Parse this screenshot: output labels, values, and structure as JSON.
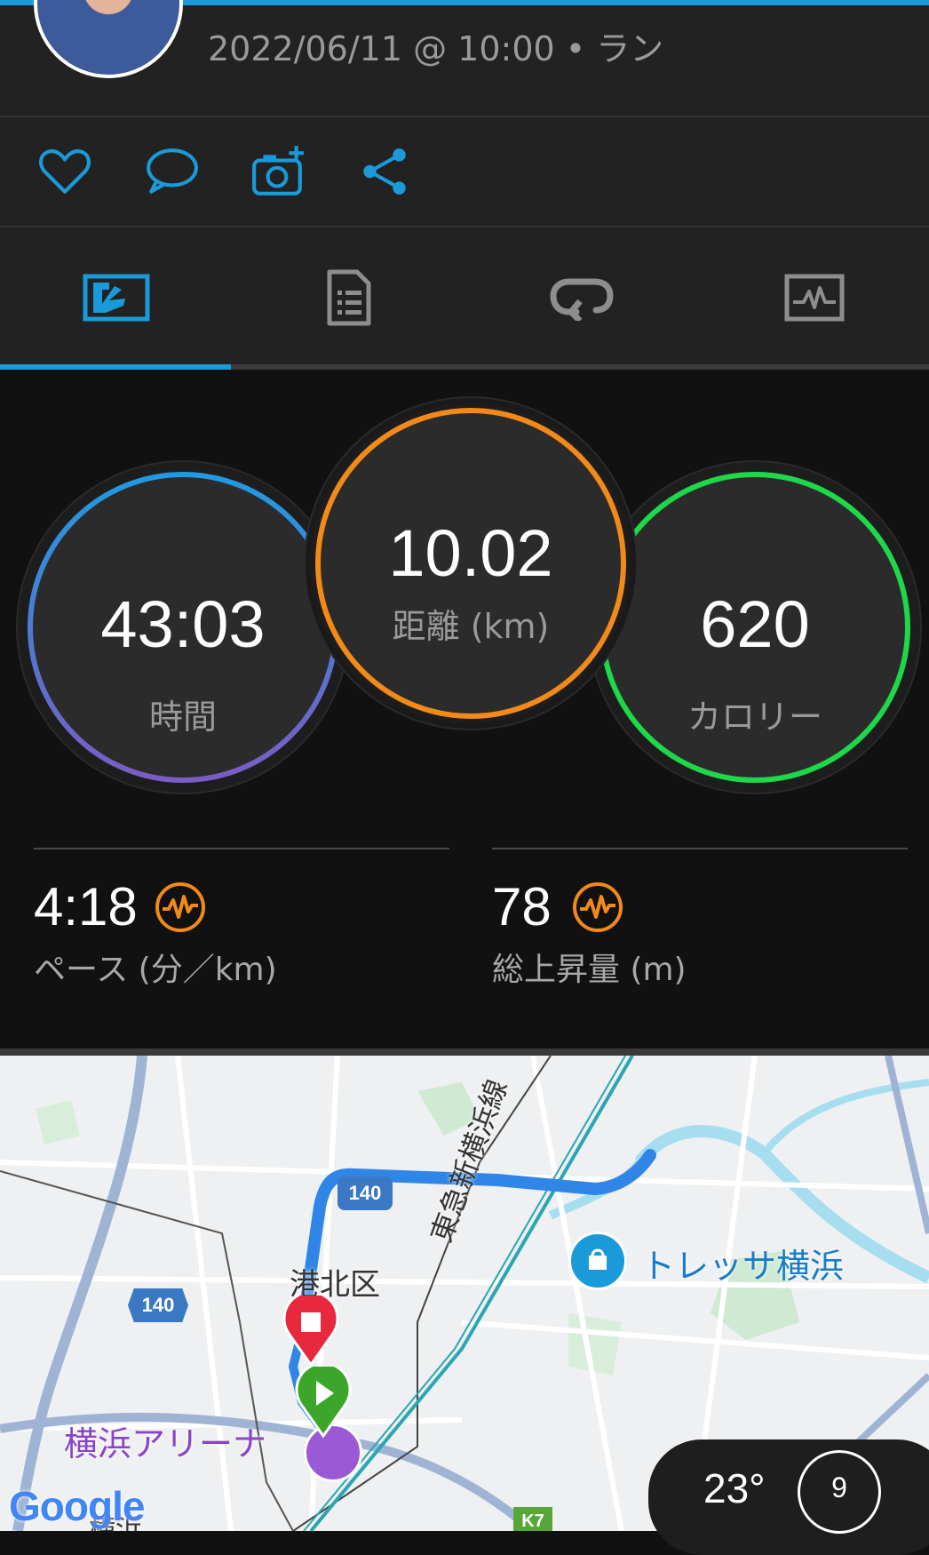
{
  "header": {
    "activity_meta": "2022/06/11 @ 10:00 • ラン"
  },
  "actions": {
    "icons": [
      "heart-icon",
      "comment-icon",
      "add-photo-icon",
      "share-icon"
    ]
  },
  "tabs": [
    {
      "icon": "overview-chart-icon",
      "selected": true
    },
    {
      "icon": "details-list-icon",
      "selected": false
    },
    {
      "icon": "laps-loop-icon",
      "selected": false
    },
    {
      "icon": "graphs-icon",
      "selected": false
    }
  ],
  "rings": {
    "time": {
      "value": "43:03",
      "label": "時間"
    },
    "distance": {
      "value": "10.02",
      "label": "距離 (km)"
    },
    "calories": {
      "value": "620",
      "label": "カロリー"
    }
  },
  "stats": {
    "pace": {
      "value": "4:18",
      "label": "ペース (分／km)"
    },
    "elevation": {
      "value": "78",
      "label": "総上昇量 (m)"
    }
  },
  "map": {
    "labels": {
      "rail_line": "東急新横浜線",
      "district": "港北区",
      "poi_shop": "トレッサ横浜",
      "poi_arena": "横浜アリーナ",
      "station_partial": "横浜",
      "google": "Google"
    },
    "road_shields": [
      "140",
      "140",
      "K7"
    ],
    "weather": {
      "temperature": "23°",
      "wind": "9"
    }
  },
  "colors": {
    "accent": "#1a9ad8",
    "time_ring_top": "#1f9ae0",
    "time_ring_bottom": "#7a5cc4",
    "distance_ring": "#f28a1a",
    "calories_ring": "#1ed84a",
    "route": "#2f86e6"
  }
}
